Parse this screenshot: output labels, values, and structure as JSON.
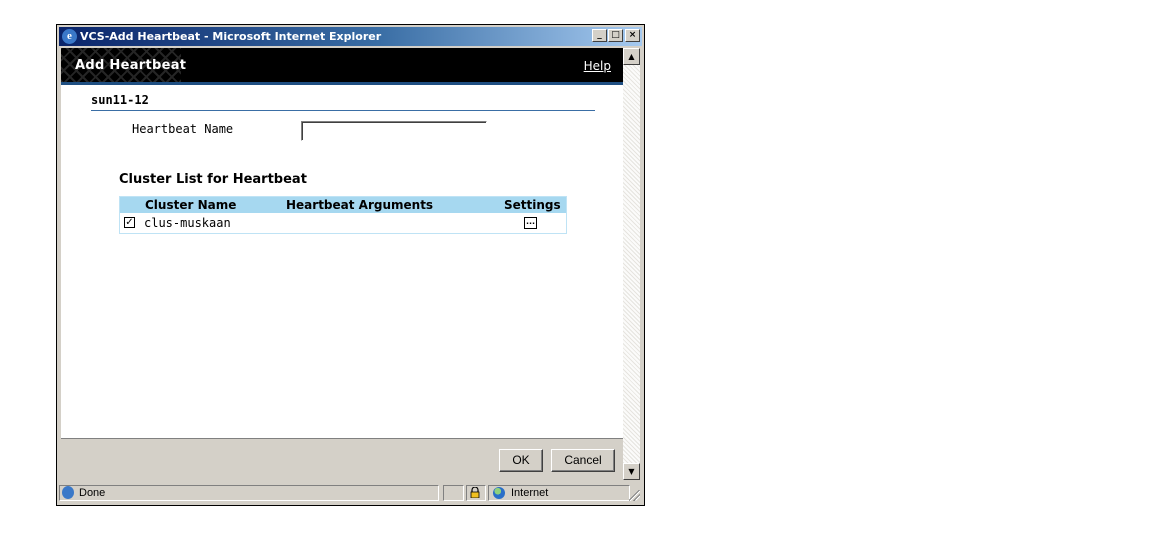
{
  "window": {
    "title": "VCS-Add Heartbeat - Microsoft Internet Explorer",
    "minimize_glyph": "_",
    "maximize_glyph": "□",
    "close_glyph": "×"
  },
  "banner": {
    "title": "Add Heartbeat",
    "help_link": "Help"
  },
  "form": {
    "host_name": "sun11-12",
    "heartbeat_name_label": "Heartbeat Name",
    "heartbeat_name_value": ""
  },
  "cluster_list": {
    "heading": "Cluster List for Heartbeat",
    "columns": [
      "Cluster Name",
      "Heartbeat Arguments",
      "Settings"
    ],
    "rows": [
      {
        "checked": true,
        "check_glyph": "✓",
        "cluster_name": "clus-muskaan",
        "heartbeat_arguments": "",
        "settings_glyph": "..."
      }
    ]
  },
  "buttons": {
    "ok": "OK",
    "cancel": "Cancel"
  },
  "scrollbar": {
    "up_glyph": "▲",
    "down_glyph": "▼"
  },
  "statusbar": {
    "status": "Done",
    "zone": "Internet"
  }
}
